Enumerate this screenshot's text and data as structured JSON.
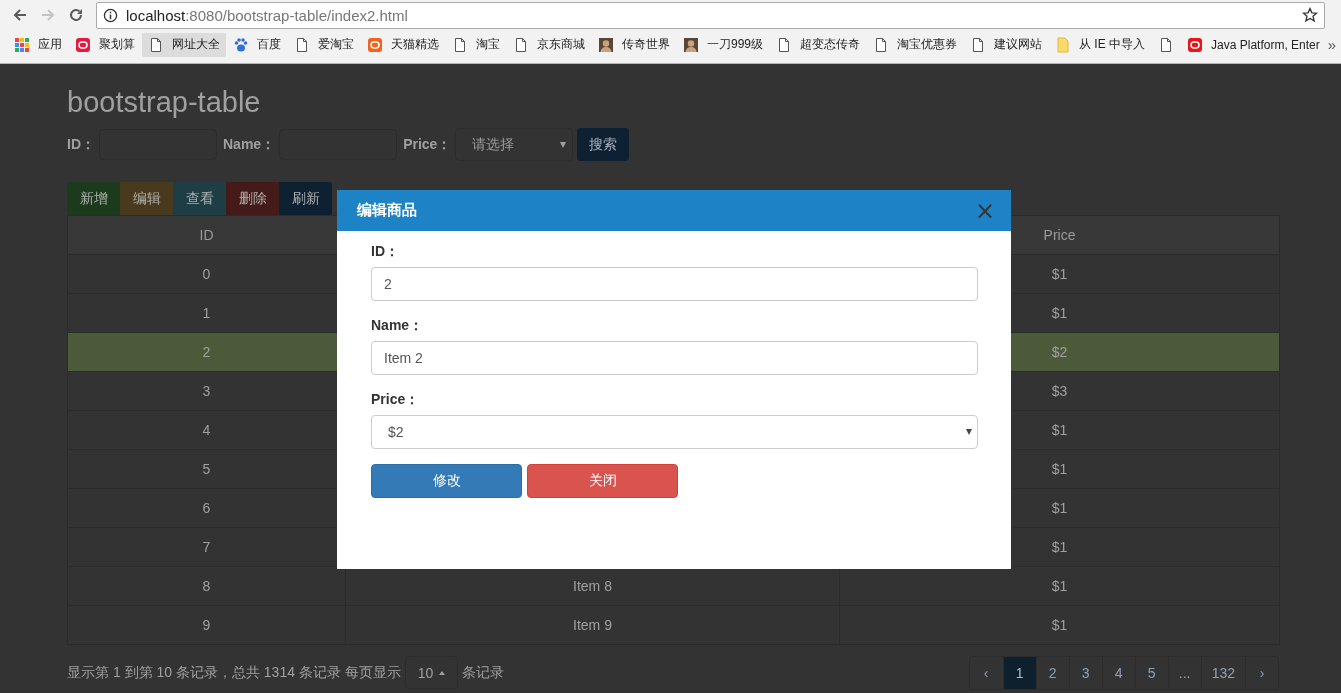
{
  "browser": {
    "url_host": "localhost",
    "url_path": ":8080/bootstrap-table/index2.html",
    "bookmarks": [
      {
        "kind": "apps",
        "label": "应用",
        "selected": false
      },
      {
        "kind": "brand",
        "label": "聚划算",
        "color": "#e8193c",
        "selected": false
      },
      {
        "kind": "page",
        "label": "网址大全",
        "selected": true
      },
      {
        "kind": "paw",
        "label": "百度",
        "selected": false
      },
      {
        "kind": "page",
        "label": "爱淘宝",
        "selected": false
      },
      {
        "kind": "brand",
        "label": "天猫精选",
        "color": "#f4621f",
        "selected": false
      },
      {
        "kind": "page",
        "label": "淘宝",
        "selected": false
      },
      {
        "kind": "page",
        "label": "京东商城",
        "selected": false
      },
      {
        "kind": "avatar",
        "label": "传奇世界",
        "selected": false
      },
      {
        "kind": "avatar",
        "label": "一刀999级",
        "selected": false
      },
      {
        "kind": "page",
        "label": "超变态传奇",
        "selected": false
      },
      {
        "kind": "page",
        "label": "淘宝优惠券",
        "selected": false
      },
      {
        "kind": "page",
        "label": "建议网站",
        "selected": false
      },
      {
        "kind": "folder",
        "label": "从 IE 中导入",
        "selected": false
      },
      {
        "kind": "page",
        "selected": false
      },
      {
        "kind": "brand",
        "label": "Java Platform, Enter",
        "color": "#e8151c",
        "selected": false
      }
    ],
    "overflow": "»"
  },
  "page": {
    "title": "bootstrap-table",
    "search": {
      "id_label": "ID：",
      "name_label": "Name：",
      "price_label": "Price：",
      "price_placeholder": "请选择",
      "button": "搜索"
    },
    "toolbar": [
      {
        "label": "新增",
        "color": "#1c3a1c"
      },
      {
        "label": "编辑",
        "color": "#4a3a1d"
      },
      {
        "label": "查看",
        "color": "#1e3d45"
      },
      {
        "label": "删除",
        "color": "#451b1a"
      },
      {
        "label": "刷新",
        "color": "#0e2133"
      }
    ],
    "table": {
      "columns": [
        "ID",
        "Price"
      ],
      "rows": [
        {
          "id": "0",
          "price": "$1",
          "selected": false
        },
        {
          "id": "1",
          "price": "$1",
          "selected": false
        },
        {
          "id": "2",
          "price": "$2",
          "selected": true
        },
        {
          "id": "3",
          "price": "$3",
          "selected": false
        },
        {
          "id": "4",
          "price": "$1",
          "selected": false
        },
        {
          "id": "5",
          "price": "$1",
          "selected": false
        },
        {
          "id": "6",
          "price": "$1",
          "selected": false
        },
        {
          "id": "7",
          "price": "$1",
          "selected": false
        },
        {
          "id": "8",
          "name": "Item 8",
          "price": "$1",
          "selected": false
        },
        {
          "id": "9",
          "name": "Item 9",
          "price": "$1",
          "selected": false
        }
      ]
    },
    "footer": {
      "summary": "显示第 1 到第 10 条记录，总共 1314 条记录 每页显示",
      "page_size": "10",
      "suffix": "条记录"
    },
    "pagination": [
      {
        "label": "‹",
        "selected": false
      },
      {
        "label": "1",
        "selected": true
      },
      {
        "label": "2",
        "selected": false
      },
      {
        "label": "3",
        "selected": false
      },
      {
        "label": "4",
        "selected": false
      },
      {
        "label": "5",
        "selected": false
      },
      {
        "label": "...",
        "selected": false
      },
      {
        "label": "132",
        "selected": false
      },
      {
        "label": "›",
        "selected": false
      }
    ]
  },
  "modal": {
    "title": "编辑商品",
    "close": "×",
    "fields": [
      {
        "kind": "input",
        "label": "ID：",
        "value": "2"
      },
      {
        "kind": "input",
        "label": "Name：",
        "value": "Item 2"
      },
      {
        "kind": "select",
        "label": "Price：",
        "value": "$2"
      }
    ],
    "buttons": [
      {
        "kind": "primary",
        "label": "修改"
      },
      {
        "kind": "danger",
        "label": "关闭"
      }
    ]
  }
}
